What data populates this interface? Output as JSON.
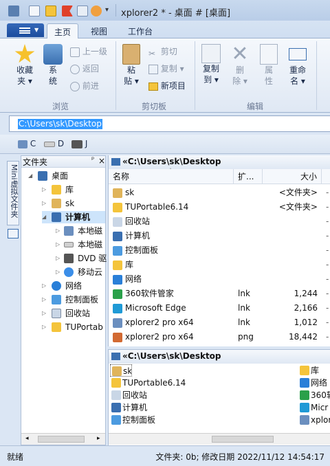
{
  "window": {
    "title": "xplorer2 * - 桌面 # [桌面]"
  },
  "ribbon": {
    "tabs": [
      "主页",
      "视图",
      "工作台"
    ],
    "groups": {
      "browse": "浏览",
      "clipboard": "剪切板",
      "edit": "编辑"
    },
    "favorites": "收藏",
    "favorites2": "夹",
    "system": "系",
    "system2": "统",
    "up": "上一级",
    "back": "返回",
    "forward": "前进",
    "paste": "粘",
    "paste2": "贴",
    "cut": "剪切",
    "copy": "复制",
    "new_item": "新项目",
    "copy_to": "复制",
    "copy_to2": "到",
    "delete": "删",
    "delete2": "除",
    "properties": "属",
    "properties2": "性",
    "rename": "重命",
    "rename2": "名"
  },
  "address": {
    "value": "C:\\Users\\sk\\Desktop"
  },
  "drives": [
    {
      "letter": "C"
    },
    {
      "letter": "D"
    },
    {
      "letter": "J"
    }
  ],
  "left_pane": {
    "header": "文件夹",
    "pin": "ᵖ",
    "close": "×",
    "side_tab": "Mini虚拟文件夹",
    "tree": [
      {
        "label": "桌面"
      },
      {
        "label": "库"
      },
      {
        "label": "sk"
      },
      {
        "label": "计算机"
      },
      {
        "label": "本地磁"
      },
      {
        "label": "本地磁"
      },
      {
        "label": "DVD 驱"
      },
      {
        "label": "移动云"
      },
      {
        "label": "网络"
      },
      {
        "label": "控制面板"
      },
      {
        "label": "回收站"
      },
      {
        "label": "TUPortab"
      }
    ]
  },
  "top_pane": {
    "path": "«C:\\Users\\sk\\Desktop",
    "columns": {
      "name": "名称",
      "ext": "扩...",
      "size": "大小"
    },
    "rows": [
      {
        "name": "sk",
        "ext": "",
        "size": "<文件夹>"
      },
      {
        "name": "TUPortable6.14",
        "ext": "",
        "size": "<文件夹>"
      },
      {
        "name": "回收站",
        "ext": "",
        "size": ""
      },
      {
        "name": "计算机",
        "ext": "",
        "size": ""
      },
      {
        "name": "控制面板",
        "ext": "",
        "size": ""
      },
      {
        "name": "库",
        "ext": "",
        "size": ""
      },
      {
        "name": "网络",
        "ext": "",
        "size": ""
      },
      {
        "name": "360软件管家",
        "ext": "lnk",
        "size": "1,244"
      },
      {
        "name": "Microsoft Edge",
        "ext": "lnk",
        "size": "2,166"
      },
      {
        "name": "xplorer2 pro x64",
        "ext": "lnk",
        "size": "1,012"
      },
      {
        "name": "xplorer2 pro x64",
        "ext": "png",
        "size": "18,442"
      }
    ]
  },
  "bottom_pane": {
    "path": "«C:\\Users\\sk\\Desktop",
    "col1": [
      "sk",
      "TUPortable6.14",
      "回收站",
      "计算机",
      "控制面板"
    ],
    "col2": [
      "库",
      "网络",
      "360软",
      "Micr",
      "xplor"
    ]
  },
  "status": {
    "left": "就绪",
    "right": "文件夹: 0b; 修改日期 2022/11/12 14:54:17"
  },
  "colors": {
    "accent": "#3399ff",
    "selected_tree": "#cde4fb"
  }
}
